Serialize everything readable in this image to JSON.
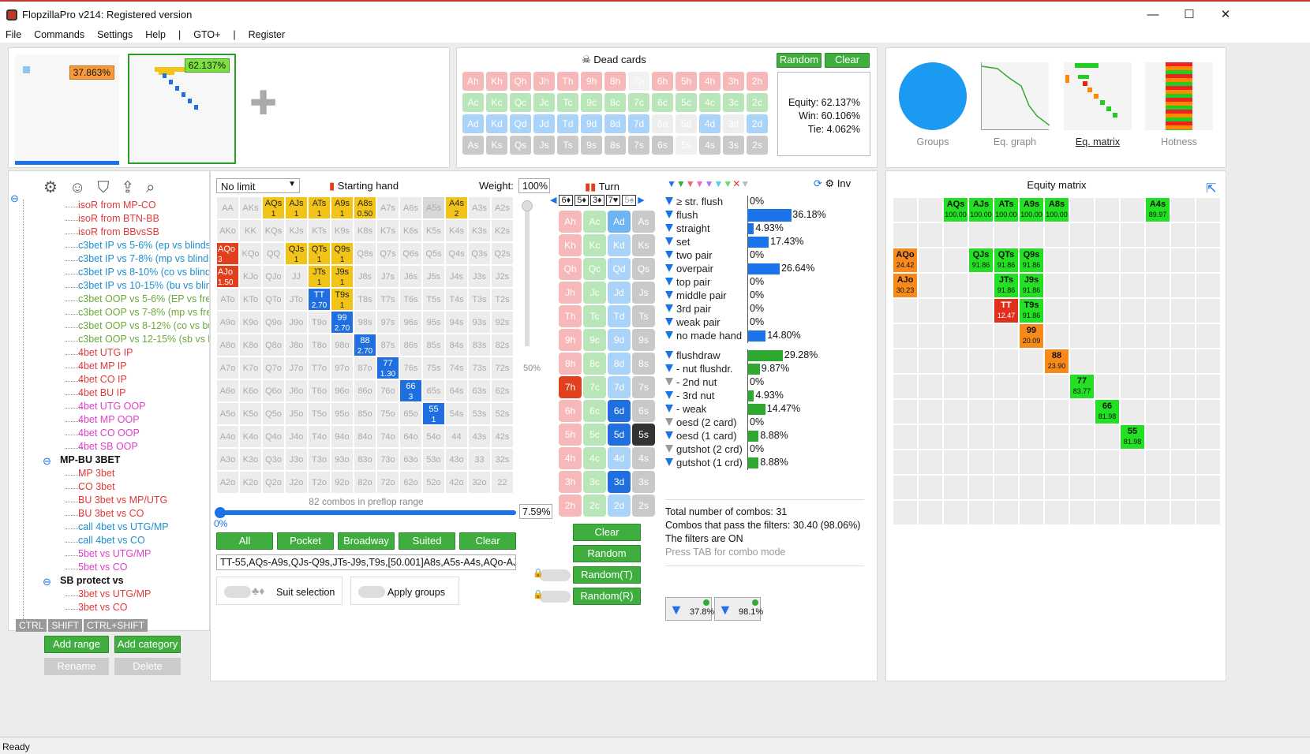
{
  "window": {
    "title": "FlopzillaPro v214: Registered version",
    "min": "—",
    "max": "☐",
    "close": "✕"
  },
  "menu": [
    "File",
    "Commands",
    "Settings",
    "Help",
    "|",
    "GTO+",
    "|",
    "Register"
  ],
  "top": {
    "range1_pct": "37.863%",
    "range2_pct": "62.137%",
    "dead_cards_title": "Dead cards",
    "random": "Random",
    "clear": "Clear",
    "equity": "Equity: 62.137%",
    "win": "Win: 60.106%",
    "tie": "Tie: 4.062%"
  },
  "views": [
    {
      "label": "Groups"
    },
    {
      "label": "Eq. graph"
    },
    {
      "label": "Eq. matrix"
    },
    {
      "label": "Hotness"
    }
  ],
  "dead_rows": [
    [
      "Ah",
      "Kh",
      "Qh",
      "Jh",
      "Th",
      "9h",
      "8h",
      "7h",
      "6h",
      "5h",
      "4h",
      "3h",
      "2h"
    ],
    [
      "Ac",
      "Kc",
      "Qc",
      "Jc",
      "Tc",
      "9c",
      "8c",
      "7c",
      "6c",
      "5c",
      "4c",
      "3c",
      "2c"
    ],
    [
      "Ad",
      "Kd",
      "Qd",
      "Jd",
      "Td",
      "9d",
      "8d",
      "7d",
      "6d",
      "5d",
      "4d",
      "3d",
      "2d"
    ],
    [
      "As",
      "Ks",
      "Qs",
      "Js",
      "Ts",
      "9s",
      "8s",
      "7s",
      "6s",
      "5s",
      "4s",
      "3s",
      "2s"
    ]
  ],
  "tree": [
    {
      "t": "isoR from MP-CO",
      "c": "#e03a3a",
      "x": 98
    },
    {
      "t": "isoR from BTN-BB",
      "c": "#e03a3a",
      "x": 98
    },
    {
      "t": "isoR from BBvsSB",
      "c": "#e03a3a",
      "x": 98
    },
    {
      "t": "c3bet IP vs 5-6% (ep vs blinds)",
      "c": "#1f8fcc",
      "x": 98
    },
    {
      "t": "c3bet IP vs 7-8% (mp vs blinds)",
      "c": "#1f8fcc",
      "x": 98
    },
    {
      "t": "c3bet IP vs 8-10% (co vs blinds)",
      "c": "#1f8fcc",
      "x": 98
    },
    {
      "t": "c3bet IP vs 10-15% (bu vs blinds)",
      "c": "#1f8fcc",
      "x": 98
    },
    {
      "t": "c3bet OOP vs 5-6% (EP vs free)",
      "c": "#6aaa3a",
      "x": 98
    },
    {
      "t": "c3bet OOP vs 7-8% (mp vs free)",
      "c": "#6aaa3a",
      "x": 98
    },
    {
      "t": "c3bet OOP vs 8-12% (co vs bu)",
      "c": "#6aaa3a",
      "x": 98
    },
    {
      "t": "c3bet OOP vs 12-15% (sb vs bb)",
      "c": "#6aaa3a",
      "x": 98
    },
    {
      "t": "4bet UTG IP",
      "c": "#e03a3a",
      "x": 98
    },
    {
      "t": "4bet MP IP",
      "c": "#e03a3a",
      "x": 98
    },
    {
      "t": "4bet CO IP",
      "c": "#e03a3a",
      "x": 98
    },
    {
      "t": "4bet BU IP",
      "c": "#e03a3a",
      "x": 98
    },
    {
      "t": "4bet UTG OOP",
      "c": "#e040c8",
      "x": 98
    },
    {
      "t": "4bet MP OOP",
      "c": "#e040c8",
      "x": 98
    },
    {
      "t": "4bet CO OOP",
      "c": "#e040c8",
      "x": 98
    },
    {
      "t": "4bet SB OOP",
      "c": "#e040c8",
      "x": 98
    },
    {
      "t": "MP-BU 3BET",
      "c": "#111",
      "x": 75,
      "bold": true
    },
    {
      "t": "MP 3bet",
      "c": "#e03a3a",
      "x": 98
    },
    {
      "t": "CO 3bet",
      "c": "#e03a3a",
      "x": 98
    },
    {
      "t": "BU 3bet vs MP/UTG",
      "c": "#e03a3a",
      "x": 98
    },
    {
      "t": "BU 3bet vs CO",
      "c": "#e03a3a",
      "x": 98
    },
    {
      "t": "call 4bet vs UTG/MP",
      "c": "#1f8fcc",
      "x": 98
    },
    {
      "t": "call 4bet vs CO",
      "c": "#1f8fcc",
      "x": 98
    },
    {
      "t": "5bet vs UTG/MP",
      "c": "#e040c8",
      "x": 98
    },
    {
      "t": "5bet vs CO",
      "c": "#e040c8",
      "x": 98
    },
    {
      "t": "SB protect vs",
      "c": "#111",
      "x": 75,
      "bold": true
    },
    {
      "t": "3bet vs UTG/MP",
      "c": "#e03a3a",
      "x": 98
    },
    {
      "t": "3bet vs CO",
      "c": "#e03a3a",
      "x": 98
    }
  ],
  "mods": [
    "CTRL",
    "SHIFT",
    "CTRL+SHIFT"
  ],
  "tree_buttons": {
    "add_range": "Add range",
    "add_category": "Add category",
    "rename": "Rename",
    "delete": "Delete"
  },
  "range": {
    "limit": "No limit",
    "starting_hand": "Starting hand",
    "weight_label": "Weight:",
    "weight": "100%",
    "combos": "82 combos in preflop range",
    "slider_pct": "7.59%",
    "slider_min": "0%",
    "side_pct": "50%",
    "buttons": [
      "All",
      "Pocket",
      "Broadway",
      "Suited",
      "Clear"
    ],
    "text": "TT-55,AQs-A9s,QJs-Q9s,JTs-J9s,T9s,[50.001]A8s,A5s-A4s,AQo-AJo",
    "suit_sel": "Suit selection",
    "apply_groups": "Apply groups"
  },
  "matrix_labels": [
    "AA",
    "AKs",
    "AQs",
    "AJs",
    "ATs",
    "A9s",
    "A8s",
    "A7s",
    "A6s",
    "A5s",
    "A4s",
    "A3s",
    "A2s",
    "AKo",
    "KK",
    "KQs",
    "KJs",
    "KTs",
    "K9s",
    "K8s",
    "K7s",
    "K6s",
    "K5s",
    "K4s",
    "K3s",
    "K2s",
    "AQo",
    "KQo",
    "QQ",
    "QJs",
    "QTs",
    "Q9s",
    "Q8s",
    "Q7s",
    "Q6s",
    "Q5s",
    "Q4s",
    "Q3s",
    "Q2s",
    "AJo",
    "KJo",
    "QJo",
    "JJ",
    "JTs",
    "J9s",
    "J8s",
    "J7s",
    "J6s",
    "J5s",
    "J4s",
    "J3s",
    "J2s",
    "ATo",
    "KTo",
    "QTo",
    "JTo",
    "TT",
    "T9s",
    "T8s",
    "T7s",
    "T6s",
    "T5s",
    "T4s",
    "T3s",
    "T2s",
    "A9o",
    "K9o",
    "Q9o",
    "J9o",
    "T9o",
    "99",
    "98s",
    "97s",
    "96s",
    "95s",
    "94s",
    "93s",
    "92s",
    "A8o",
    "K8o",
    "Q8o",
    "J8o",
    "T8o",
    "98o",
    "88",
    "87s",
    "86s",
    "85s",
    "84s",
    "83s",
    "82s",
    "A7o",
    "K7o",
    "Q7o",
    "J7o",
    "T7o",
    "97o",
    "87o",
    "77",
    "76s",
    "75s",
    "74s",
    "73s",
    "72s",
    "A6o",
    "K6o",
    "Q6o",
    "J6o",
    "T6o",
    "96o",
    "86o",
    "76o",
    "66",
    "65s",
    "64s",
    "63s",
    "62s",
    "A5o",
    "K5o",
    "Q5o",
    "J5o",
    "T5o",
    "95o",
    "85o",
    "75o",
    "65o",
    "55",
    "54s",
    "53s",
    "52s",
    "A4o",
    "K4o",
    "Q4o",
    "J4o",
    "T4o",
    "94o",
    "84o",
    "74o",
    "64o",
    "54o",
    "44",
    "43s",
    "42s",
    "A3o",
    "K3o",
    "Q3o",
    "J3o",
    "T3o",
    "93o",
    "83o",
    "73o",
    "63o",
    "53o",
    "43o",
    "33",
    "32s",
    "A2o",
    "K2o",
    "Q2o",
    "J2o",
    "T2o",
    "92o",
    "82o",
    "72o",
    "62o",
    "52o",
    "42o",
    "32o",
    "22"
  ],
  "matrix_special": {
    "AQs": [
      "y",
      "1"
    ],
    "AJs": [
      "y",
      "1"
    ],
    "ATs": [
      "y",
      "1"
    ],
    "A9s": [
      "y",
      "1"
    ],
    "A8s": [
      "y",
      "0.50"
    ],
    "A4s": [
      "y",
      "2"
    ],
    "QJs": [
      "y",
      "1"
    ],
    "QTs": [
      "y",
      "1"
    ],
    "Q9s": [
      "y",
      "1"
    ],
    "JTs": [
      "y",
      "1"
    ],
    "J9s": [
      "y",
      "1"
    ],
    "T9s": [
      "y",
      "1"
    ],
    "TT": [
      "b",
      "2.70"
    ],
    "99": [
      "b",
      "2.70"
    ],
    "88": [
      "b",
      "2.70"
    ],
    "77": [
      "b",
      "1.30"
    ],
    "66": [
      "b",
      "3"
    ],
    "55": [
      "b",
      "1"
    ],
    "AQo": [
      "r",
      "3"
    ],
    "AJo": [
      "r",
      "1.50"
    ],
    "A5s": [
      "g",
      ""
    ]
  },
  "turn": {
    "title": "Turn",
    "suits": [
      "6♦",
      "5♦",
      "3♦",
      "7♥",
      "5♠"
    ],
    "cols": [
      [
        "Ah",
        "Kh",
        "Qh",
        "Jh",
        "Th",
        "9h",
        "8h",
        "7h",
        "6h",
        "5h",
        "4h",
        "3h",
        "2h"
      ],
      [
        "Ac",
        "Kc",
        "Qc",
        "Jc",
        "Tc",
        "9c",
        "8c",
        "7c",
        "6c",
        "5c",
        "4c",
        "3c",
        "2c"
      ],
      [
        "Ad",
        "Kd",
        "Qd",
        "Jd",
        "Td",
        "9d",
        "8d",
        "7d",
        "6d",
        "5d",
        "4d",
        "3d",
        "2d"
      ],
      [
        "As",
        "Ks",
        "Qs",
        "Js",
        "Ts",
        "9s",
        "8s",
        "7s",
        "6s",
        "5s",
        "4s",
        "3s",
        "2s"
      ]
    ],
    "buttons": [
      "Clear",
      "Random",
      "Random(T)",
      "Random(R)"
    ]
  },
  "filters": {
    "inv": "Inv",
    "made": [
      [
        "≥ str. flush",
        "0%",
        0
      ],
      [
        "flush",
        "36.18%",
        36.18
      ],
      [
        "straight",
        "4.93%",
        4.93
      ],
      [
        "set",
        "17.43%",
        17.43
      ],
      [
        "two pair",
        "0%",
        0
      ],
      [
        "overpair",
        "26.64%",
        26.64
      ],
      [
        "top pair",
        "0%",
        0
      ],
      [
        "middle pair",
        "0%",
        0
      ],
      [
        "3rd pair",
        "0%",
        0
      ],
      [
        "weak pair",
        "0%",
        0
      ],
      [
        "no made hand",
        "14.80%",
        14.8
      ]
    ],
    "draws": [
      [
        "flushdraw",
        "29.28%",
        29.28
      ],
      [
        "- nut flushdr.",
        "9.87%",
        9.87
      ],
      [
        "- 2nd nut",
        "0%",
        0
      ],
      [
        "- 3rd nut",
        "4.93%",
        4.93
      ],
      [
        "- weak",
        "14.47%",
        14.47
      ],
      [
        "oesd (2 card)",
        "0%",
        0
      ],
      [
        "oesd (1 card)",
        "8.88%",
        8.88
      ],
      [
        "gutshot (2 crd)",
        "0%",
        0
      ],
      [
        "gutshot (1 crd)",
        "8.88%",
        8.88
      ]
    ],
    "total": "Total number of combos: 31",
    "pass": "Combos that pass the filters: 30.40 (98.06%)",
    "on": "The filters are ON",
    "tab": "Press TAB for combo mode",
    "f1": "37.8%",
    "f2": "98.1%"
  },
  "eqm": {
    "title": "Equity matrix",
    "cells": [
      {
        "r": 0,
        "c": 2,
        "n": "AQs",
        "v": "100.00",
        "k": "g"
      },
      {
        "r": 0,
        "c": 3,
        "n": "AJs",
        "v": "100.00",
        "k": "g"
      },
      {
        "r": 0,
        "c": 4,
        "n": "ATs",
        "v": "100.00",
        "k": "g"
      },
      {
        "r": 0,
        "c": 5,
        "n": "A9s",
        "v": "100.00",
        "k": "g"
      },
      {
        "r": 0,
        "c": 6,
        "n": "A8s",
        "v": "100.00",
        "k": "g"
      },
      {
        "r": 0,
        "c": 10,
        "n": "A4s",
        "v": "89.97",
        "k": "g"
      },
      {
        "r": 2,
        "c": 0,
        "n": "AQo",
        "v": "24.42",
        "k": "o"
      },
      {
        "r": 2,
        "c": 3,
        "n": "QJs",
        "v": "91.86",
        "k": "g"
      },
      {
        "r": 2,
        "c": 4,
        "n": "QTs",
        "v": "91.86",
        "k": "g"
      },
      {
        "r": 2,
        "c": 5,
        "n": "Q9s",
        "v": "91.86",
        "k": "g"
      },
      {
        "r": 3,
        "c": 0,
        "n": "AJo",
        "v": "30.23",
        "k": "o"
      },
      {
        "r": 3,
        "c": 4,
        "n": "JTs",
        "v": "91.86",
        "k": "g"
      },
      {
        "r": 3,
        "c": 5,
        "n": "J9s",
        "v": "91.86",
        "k": "g"
      },
      {
        "r": 4,
        "c": 4,
        "n": "TT",
        "v": "12.47",
        "k": "rr"
      },
      {
        "r": 4,
        "c": 5,
        "n": "T9s",
        "v": "91.86",
        "k": "g"
      },
      {
        "r": 5,
        "c": 5,
        "n": "99",
        "v": "20.09",
        "k": "o"
      },
      {
        "r": 6,
        "c": 6,
        "n": "88",
        "v": "23.90",
        "k": "o"
      },
      {
        "r": 7,
        "c": 7,
        "n": "77",
        "v": "83.77",
        "k": "g"
      },
      {
        "r": 8,
        "c": 8,
        "n": "66",
        "v": "81.98",
        "k": "g"
      },
      {
        "r": 9,
        "c": 9,
        "n": "55",
        "v": "81.98",
        "k": "g"
      }
    ]
  },
  "status": "Ready"
}
